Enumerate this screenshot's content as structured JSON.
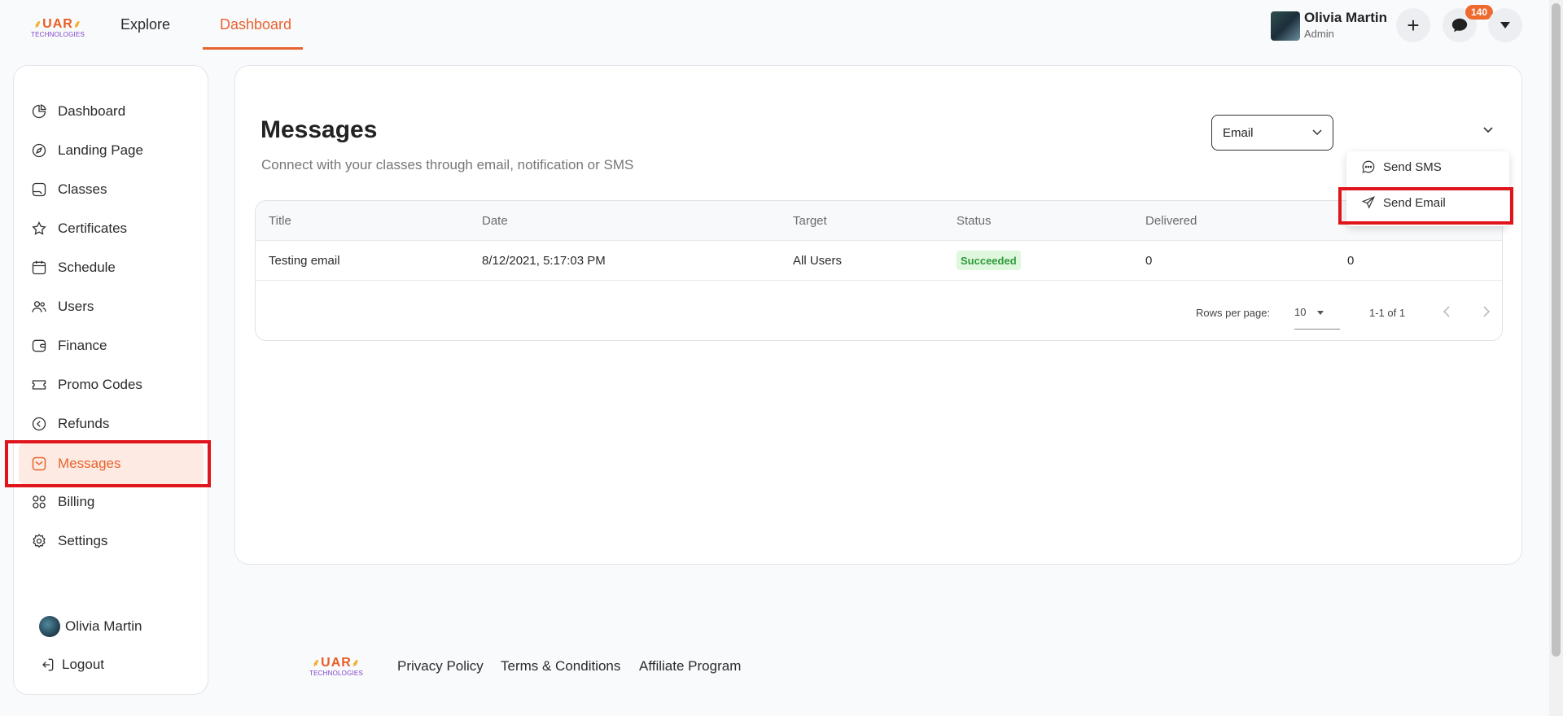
{
  "brand": {
    "logo_top": "UAR",
    "logo_bottom": "TECHNOLOGIES"
  },
  "header": {
    "nav": [
      {
        "label": "Explore"
      },
      {
        "label": "Dashboard",
        "active": true
      }
    ],
    "user": {
      "name": "Olivia Martin",
      "role": "Admin"
    },
    "actions": {
      "plus_label": "+",
      "chat_badge": "140"
    }
  },
  "sidebar": {
    "items": [
      {
        "label": "Dashboard",
        "icon": "pie-chart-icon"
      },
      {
        "label": "Landing Page",
        "icon": "compass-icon"
      },
      {
        "label": "Classes",
        "icon": "folder-icon"
      },
      {
        "label": "Certificates",
        "icon": "star-icon"
      },
      {
        "label": "Schedule",
        "icon": "calendar-icon"
      },
      {
        "label": "Users",
        "icon": "users-icon"
      },
      {
        "label": "Finance",
        "icon": "wallet-icon"
      },
      {
        "label": "Promo Codes",
        "icon": "ticket-icon"
      },
      {
        "label": "Refunds",
        "icon": "refund-icon"
      },
      {
        "label": "Messages",
        "icon": "message-icon",
        "active": true
      },
      {
        "label": "Billing",
        "icon": "grid-icon"
      },
      {
        "label": "Settings",
        "icon": "gear-icon"
      }
    ],
    "user_name": "Olivia Martin",
    "logout_label": "Logout"
  },
  "main": {
    "title": "Messages",
    "subtitle": "Connect with your classes through email, notification or SMS",
    "channel_select": {
      "value": "Email"
    },
    "table": {
      "columns": [
        "Title",
        "Date",
        "Target",
        "Status",
        "Delivered",
        ""
      ],
      "rows": [
        {
          "title": "Testing email",
          "date": "8/12/2021, 5:17:03 PM",
          "target": "All Users",
          "status": "Succeeded",
          "delivered": "0",
          "extra": "0"
        }
      ],
      "pagination": {
        "rows_per_page_label": "Rows per page:",
        "rows_per_page": "10",
        "range": "1-1 of 1"
      }
    },
    "menu": {
      "items": [
        {
          "label": "Send SMS",
          "icon": "chat-bubble-icon"
        },
        {
          "label": "Send Email",
          "icon": "send-icon"
        }
      ]
    }
  },
  "footer": {
    "links": [
      "Privacy Policy",
      "Terms & Conditions",
      "Affiliate Program"
    ]
  },
  "colors": {
    "accent": "#e8622d",
    "highlight": "#e0141b",
    "success_bg": "#dff7dd",
    "success_text": "#2e9a3a"
  }
}
